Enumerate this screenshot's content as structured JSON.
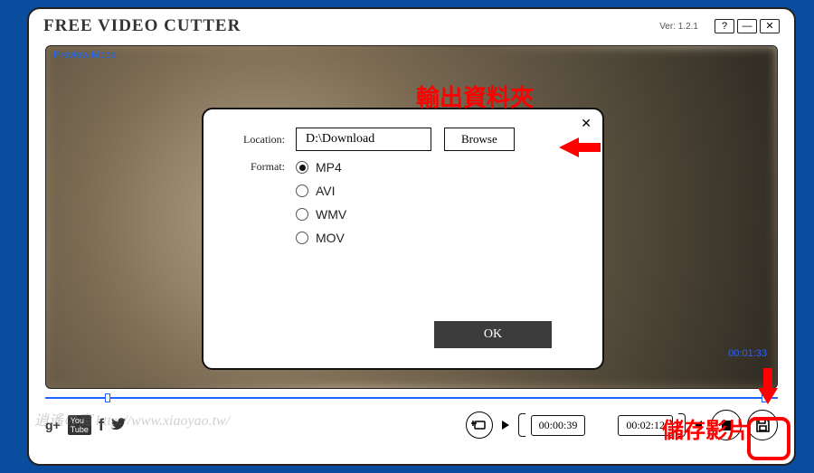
{
  "app": {
    "title": "FREE VIDEO CUTTER",
    "version": "Ver: 1.2.1"
  },
  "window_buttons": {
    "about": "?",
    "minimize": "—",
    "close": "✕"
  },
  "preview_mode_label": "Preview Mode",
  "dialog": {
    "location_label": "Location:",
    "location_value": "D:\\Download",
    "browse_label": "Browse",
    "format_label": "Format:",
    "formats": [
      "MP4",
      "AVI",
      "WMV",
      "MOV"
    ],
    "selected_format": "MP4",
    "ok_label": "OK",
    "close_x": "✕"
  },
  "timeline": {
    "total": "00:01:33",
    "start": "00:00:39",
    "end": "00:02:12"
  },
  "social": {
    "gplus": "g+",
    "youtube": "▶",
    "facebook": "f",
    "twitter": "🐦"
  },
  "annotations": {
    "output_folder": "輸出資料夾",
    "save_video": "儲存影片"
  },
  "watermark": "逍遙の窩  http://www.xiaoyao.tw/"
}
